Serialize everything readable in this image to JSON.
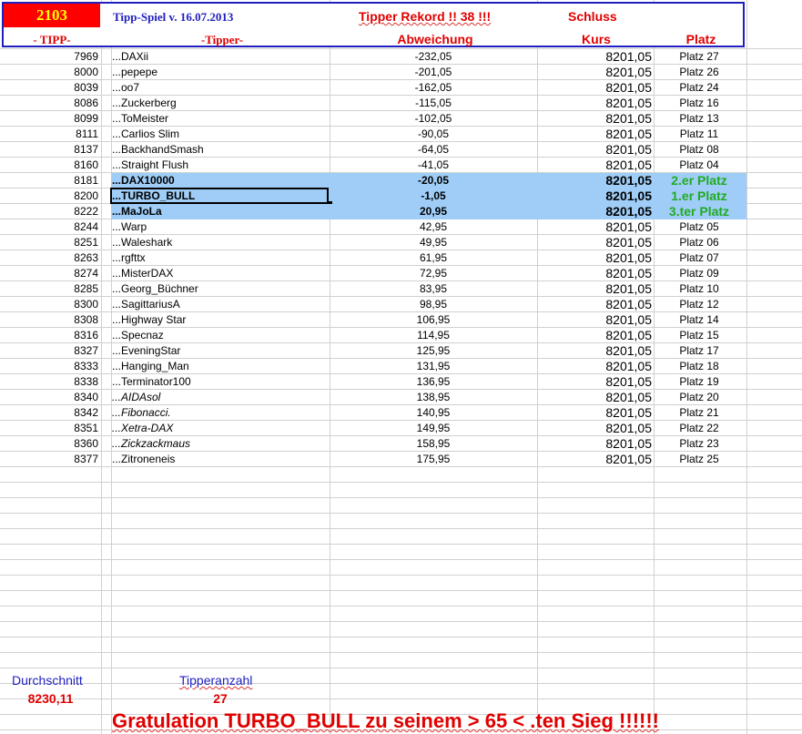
{
  "header": {
    "number": "2103",
    "title": "Tipp-Spiel v. 16.07.2013",
    "rekord": "Tipper Rekord !!  38  !!!",
    "schluss": "Schluss",
    "col_tipp": "- TIPP-",
    "col_tipper": "-Tipper-",
    "col_abweichung": "Abweichung",
    "col_kurs": "Kurs",
    "col_platz": "Platz"
  },
  "colors": {
    "header_red": "#ff0000",
    "header_number_yellow": "#ffff00",
    "border_blue": "#1f1fbf",
    "title_blue": "#1f1fbf",
    "highlight_row": "#9fcdf7",
    "winner_green": "#22aa22"
  },
  "rows": [
    {
      "tipp": "7969",
      "tipper": "...DAXii",
      "abw": "-232,05",
      "kurs": "8201,05",
      "platz": "Platz 27"
    },
    {
      "tipp": "8000",
      "tipper": "...pepepe",
      "abw": "-201,05",
      "kurs": "8201,05",
      "platz": "Platz 26"
    },
    {
      "tipp": "8039",
      "tipper": "...oo7",
      "abw": "-162,05",
      "kurs": "8201,05",
      "platz": "Platz 24"
    },
    {
      "tipp": "8086",
      "tipper": "...Zuckerberg",
      "abw": "-115,05",
      "kurs": "8201,05",
      "platz": "Platz 16"
    },
    {
      "tipp": "8099",
      "tipper": "...ToMeister",
      "abw": "-102,05",
      "kurs": "8201,05",
      "platz": "Platz 13"
    },
    {
      "tipp": "8111",
      "tipper": "...Carlios Slim",
      "abw": "-90,05",
      "kurs": "8201,05",
      "platz": "Platz 11"
    },
    {
      "tipp": "8137",
      "tipper": "...BackhandSmash",
      "abw": "-64,05",
      "kurs": "8201,05",
      "platz": "Platz 08"
    },
    {
      "tipp": "8160",
      "tipper": "...Straight Flush",
      "abw": "-41,05",
      "kurs": "8201,05",
      "platz": "Platz 04"
    },
    {
      "tipp": "8181",
      "tipper": "...DAX10000",
      "abw": "-20,05",
      "kurs": "8201,05",
      "platz": "2.er Platz",
      "highlight": true
    },
    {
      "tipp": "8200",
      "tipper": "...TURBO_BULL",
      "abw": "-1,05",
      "kurs": "8201,05",
      "platz": "1.er Platz",
      "highlight": true,
      "selected": true
    },
    {
      "tipp": "8222",
      "tipper": "...MaJoLa",
      "abw": "20,95",
      "kurs": "8201,05",
      "platz": "3.ter Platz",
      "highlight": true
    },
    {
      "tipp": "8244",
      "tipper": "...Warp",
      "abw": "42,95",
      "kurs": "8201,05",
      "platz": "Platz 05"
    },
    {
      "tipp": "8251",
      "tipper": "...Waleshark",
      "abw": "49,95",
      "kurs": "8201,05",
      "platz": "Platz 06"
    },
    {
      "tipp": "8263",
      "tipper": "...rgfttx",
      "abw": "61,95",
      "kurs": "8201,05",
      "platz": "Platz 07"
    },
    {
      "tipp": "8274",
      "tipper": "...MisterDAX",
      "abw": "72,95",
      "kurs": "8201,05",
      "platz": "Platz 09"
    },
    {
      "tipp": "8285",
      "tipper": "...Georg_Büchner",
      "abw": "83,95",
      "kurs": "8201,05",
      "platz": "Platz 10"
    },
    {
      "tipp": "8300",
      "tipper": "...SagittariusA",
      "abw": "98,95",
      "kurs": "8201,05",
      "platz": "Platz 12"
    },
    {
      "tipp": "8308",
      "tipper": "...Highway Star",
      "abw": "106,95",
      "kurs": "8201,05",
      "platz": "Platz 14"
    },
    {
      "tipp": "8316",
      "tipper": "...Specnaz",
      "abw": "114,95",
      "kurs": "8201,05",
      "platz": "Platz 15"
    },
    {
      "tipp": "8327",
      "tipper": "...EveningStar",
      "abw": "125,95",
      "kurs": "8201,05",
      "platz": "Platz 17"
    },
    {
      "tipp": "8333",
      "tipper": "...Hanging_Man",
      "abw": "131,95",
      "kurs": "8201,05",
      "platz": "Platz 18"
    },
    {
      "tipp": "8338",
      "tipper": "...Terminator100",
      "abw": "136,95",
      "kurs": "8201,05",
      "platz": "Platz 19"
    },
    {
      "tipp": "8340",
      "tipper": "...AIDAsol",
      "abw": "138,95",
      "kurs": "8201,05",
      "platz": "Platz 20",
      "italic": true
    },
    {
      "tipp": "8342",
      "tipper": "...Fibonacci.",
      "abw": "140,95",
      "kurs": "8201,05",
      "platz": "Platz 21",
      "italic": true
    },
    {
      "tipp": "8351",
      "tipper": "...Xetra-DAX",
      "abw": "149,95",
      "kurs": "8201,05",
      "platz": "Platz 22",
      "italic": true
    },
    {
      "tipp": "8360",
      "tipper": "...Zickzackmaus",
      "abw": "158,95",
      "kurs": "8201,05",
      "platz": "Platz 23",
      "italic": true
    },
    {
      "tipp": "8377",
      "tipper": "...Zitroneneis",
      "abw": "175,95",
      "kurs": "8201,05",
      "platz": "Platz 25"
    }
  ],
  "footer": {
    "durchschnitt_label": "Durchschnitt",
    "durchschnitt_value": "8230,11",
    "tipperanzahl_label": "Tipperanzahl",
    "tipperanzahl_value": "27",
    "gratulation": "Gratulation TURBO_BULL  zu seinem > 65 < .ten Sieg !!!!!!"
  }
}
